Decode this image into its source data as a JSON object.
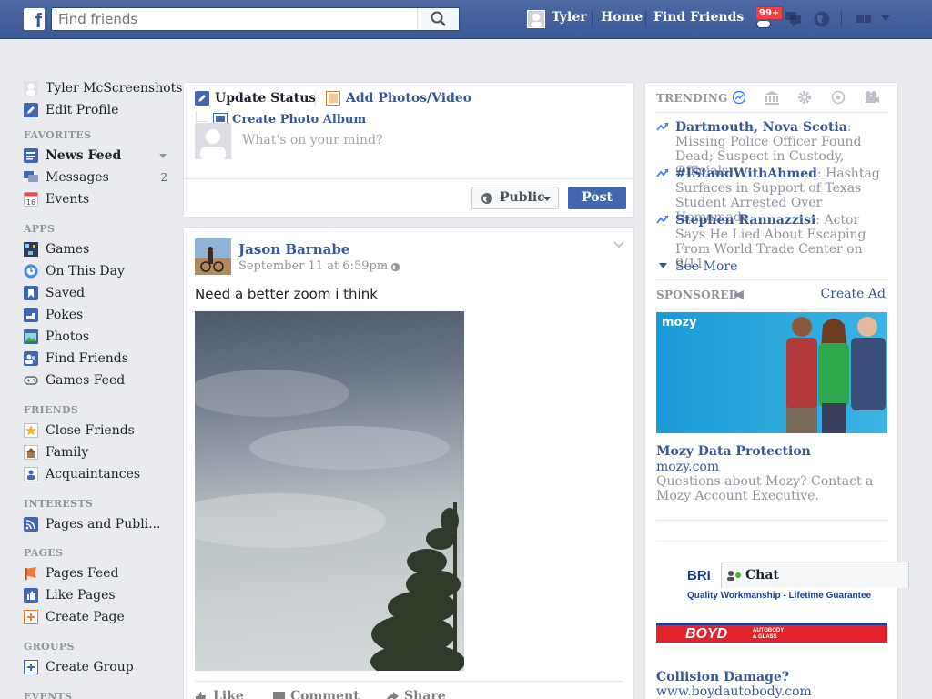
{
  "topbar": {
    "search_placeholder": "Find friends",
    "user_name": "Tyler",
    "home_label": "Home",
    "find_friends_label": "Find Friends",
    "notification_count": "99+"
  },
  "leftnav": {
    "profile_name": "Tyler McScreenshots",
    "edit_profile": "Edit Profile",
    "favorites_heading": "FAVORITES",
    "favorites": [
      {
        "label": "News Feed"
      },
      {
        "label": "Messages",
        "count": "2"
      },
      {
        "label": "Events",
        "icon_text": "16"
      }
    ],
    "apps_heading": "APPS",
    "apps": [
      {
        "label": "Games"
      },
      {
        "label": "On This Day"
      },
      {
        "label": "Saved"
      },
      {
        "label": "Pokes"
      },
      {
        "label": "Photos"
      },
      {
        "label": "Find Friends"
      },
      {
        "label": "Games Feed"
      }
    ],
    "friends_heading": "FRIENDS",
    "friends": [
      {
        "label": "Close Friends"
      },
      {
        "label": "Family"
      },
      {
        "label": "Acquaintances"
      }
    ],
    "interests_heading": "INTERESTS",
    "interests": [
      {
        "label": "Pages and Publi..."
      }
    ],
    "pages_heading": "PAGES",
    "pages": [
      {
        "label": "Pages Feed"
      },
      {
        "label": "Like Pages"
      },
      {
        "label": "Create Page"
      }
    ],
    "groups_heading": "GROUPS",
    "groups": [
      {
        "label": "Create Group"
      }
    ],
    "events_heading": "EVENTS"
  },
  "composer": {
    "update_status": "Update Status",
    "add_photos": "Add Photos/Video",
    "create_album": "Create Photo Album",
    "placeholder": "What's on your mind?",
    "audience": "Public",
    "post_label": "Post"
  },
  "post": {
    "author": "Jason Barnabe",
    "timestamp": "September 11 at 6:59pm",
    "dot": "·",
    "text": "Need a better zoom i think",
    "actions": [
      "Like",
      "Comment",
      "Share"
    ]
  },
  "trending": {
    "heading": "TRENDING",
    "items": [
      {
        "title": "Dartmouth, Nova Scotia",
        "text": "Missing Police Officer Found Dead; Suspect in Custody, Officials"
      },
      {
        "title": "#IStandWithAhmed",
        "text": "Hashtag Surfaces in Support of Texas Student Arrested Over Homemade"
      },
      {
        "title": "Stephen Rannazzisi",
        "text": "Actor Says He Lied About Escaping From World Trade Center on 9/11"
      }
    ],
    "see_more": "See More"
  },
  "sponsored": {
    "heading": "SPONSORED",
    "create_ad": "Create Ad",
    "ads": [
      {
        "logo": "mozy",
        "title": "Mozy Data Protection",
        "domain": "mozy.com",
        "body": "Questions about Mozy? Contact a Mozy Account Executive."
      },
      {
        "logo_brand": "BRI",
        "tagline": "Quality Workmanship - Lifetime Guarantee",
        "banner": "BOYD",
        "banner_sub": "AUTOBODY & GLASS",
        "title": "Collision Damage?",
        "domain": "www.boydautobody.com"
      }
    ]
  },
  "chat": {
    "label": "Chat"
  },
  "colors": {
    "brand": "#3b5998",
    "link": "#365899",
    "badge": "#fa3e3e",
    "post_button": "#4267b2"
  }
}
